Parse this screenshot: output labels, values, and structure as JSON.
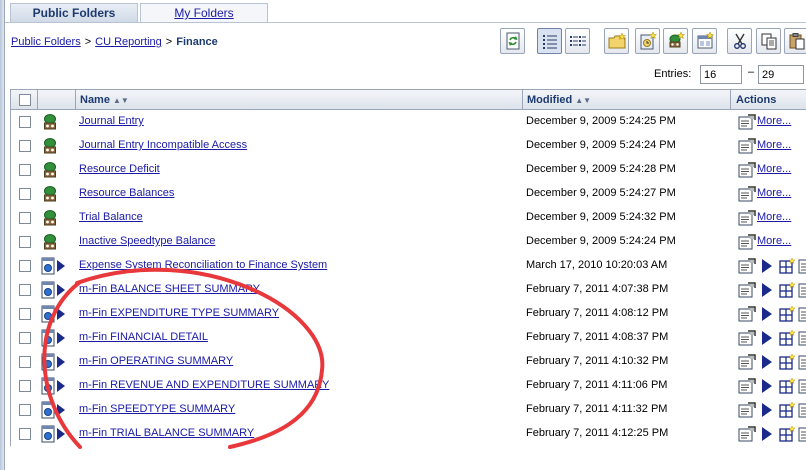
{
  "tabs": [
    {
      "label": "Public Folders",
      "active": true
    },
    {
      "label": "My Folders",
      "active": false
    }
  ],
  "breadcrumb": {
    "items": [
      "Public Folders",
      "CU Reporting"
    ],
    "separator": ">",
    "current": "Finance"
  },
  "toolbar": {
    "buttons": [
      "refresh-icon",
      "details-view-icon",
      "list-view-icon",
      "new-folder-icon",
      "new-job-icon",
      "new-page-icon",
      "new-url-icon",
      "cut-icon",
      "copy-icon",
      "paste-icon"
    ]
  },
  "entries": {
    "label": "Entries:",
    "from": "16",
    "dash": "–",
    "to": "29"
  },
  "table": {
    "headers": {
      "name": "Name",
      "modified": "Modified",
      "actions": "Actions"
    },
    "rows": [
      {
        "kind": "package",
        "name": "Journal Entry",
        "modified": "December 9, 2009 5:24:25 PM",
        "action": "More..."
      },
      {
        "kind": "package",
        "name": "Journal Entry Incompatible Access",
        "modified": "December 9, 2009 5:24:24 PM",
        "action": "More..."
      },
      {
        "kind": "package",
        "name": "Resource Deficit",
        "modified": "December 9, 2009 5:24:28 PM",
        "action": "More..."
      },
      {
        "kind": "package",
        "name": "Resource Balances",
        "modified": "December 9, 2009 5:24:27 PM",
        "action": "More..."
      },
      {
        "kind": "package",
        "name": "Trial Balance",
        "modified": "December 9, 2009 5:24:32 PM",
        "action": "More..."
      },
      {
        "kind": "package",
        "name": "Inactive Speedtype Balance",
        "modified": "December 9, 2009 5:24:24 PM",
        "action": "More..."
      },
      {
        "kind": "report",
        "name": "Expense System Reconciliation to Finance System",
        "modified": "March 17, 2010 10:20:03 AM"
      },
      {
        "kind": "report",
        "name": "m-Fin BALANCE SHEET SUMMARY",
        "modified": "February 7, 2011 4:07:38 PM"
      },
      {
        "kind": "report",
        "name": "m-Fin EXPENDITURE TYPE SUMMARY",
        "modified": "February 7, 2011 4:08:12 PM"
      },
      {
        "kind": "report",
        "name": "m-Fin FINANCIAL DETAIL",
        "modified": "February 7, 2011 4:08:37 PM"
      },
      {
        "kind": "report",
        "name": "m-Fin OPERATING SUMMARY",
        "modified": "February 7, 2011 4:10:32 PM"
      },
      {
        "kind": "report",
        "name": "m-Fin REVENUE AND EXPENDITURE SUMMARY",
        "modified": "February 7, 2011 4:11:06 PM"
      },
      {
        "kind": "report",
        "name": "m-Fin SPEEDTYPE SUMMARY",
        "modified": "February 7, 2011 4:11:32 PM"
      },
      {
        "kind": "report",
        "name": "m-Fin TRIAL BALANCE SUMMARY",
        "modified": "February 7, 2011 4:12:25 PM"
      }
    ]
  },
  "annotation": {
    "color": "#e8383b"
  }
}
